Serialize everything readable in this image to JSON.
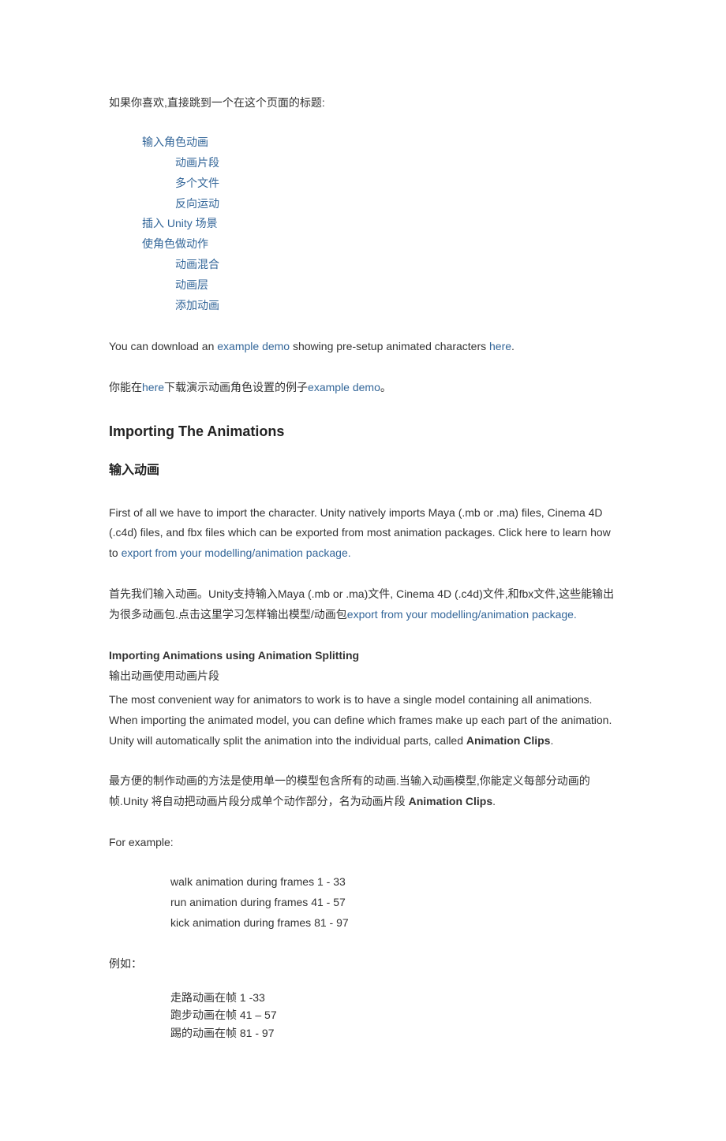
{
  "intro_zh": "如果你喜欢,直接跳到一个在这个页面的标题:",
  "toc": {
    "a": "输入角色动画",
    "a1": "动画片段",
    "a2": "多个文件",
    "a3": "反向运动",
    "b": "插入 Unity 场景",
    "c": "使角色做动作",
    "c1": "动画混合",
    "c2": "动画层",
    "c3": "添加动画"
  },
  "dl_en_1": "You can download an ",
  "dl_en_link1": "example demo",
  "dl_en_2": " showing pre-setup animated characters ",
  "dl_en_link2": "here",
  "dl_en_3": ".",
  "dl_zh_1": "你能在",
  "dl_zh_link1": "here",
  "dl_zh_2": "下载演示动画角色设置的例子",
  "dl_zh_link2": "example demo",
  "dl_zh_3": "。",
  "h2_en": "Importing The Animations",
  "h3_zh": "输入动画",
  "import_en_1": "First of all we have to import the character. Unity natively imports Maya (.mb or .ma) files, Cinema 4D (.c4d) files, and fbx files which can be exported from most animation packages. Click here to learn how to ",
  "import_en_link": "export from your modelling/animation package.",
  "import_zh_1": "首先我们输入动画。Unity支持输入Maya (.mb or .ma)文件, Cinema 4D (.c4d)文件,和fbx文件,这些能输出为很多动画包.点击这里学习怎样输出模型/动画包",
  "import_zh_link": "export from your modelling/animation package.",
  "split_h_en": "Importing Animations using Animation Splitting",
  "split_h_zh": "输出动画使用动画片段",
  "split_body_en_1": "The most convenient way for animators to work is to have a single model containing all animations. When importing the animated model, you can define which frames make up each part of the animation. Unity will automatically split the animation into the individual parts, called ",
  "split_body_en_bold": "Animation Clips",
  "split_body_en_2": ".",
  "split_body_zh_1": "最方便的制作动画的方法是使用单一的模型包含所有的动画.当输入动画模型,你能定义每部分动画的帧.Unity 将自动把动画片段分成单个动作部分，名为动画片段 ",
  "split_body_zh_bold": "Animation Clips",
  "split_body_zh_2": ".",
  "for_example": "For example:",
  "ex_en_1": "walk animation during frames 1 - 33",
  "ex_en_2": "run animation during frames 41 - 57",
  "ex_en_3": "kick animation during frames 81 - 97",
  "for_example_zh": "例如：",
  "ex_zh_1": "走路动画在帧 1 -33",
  "ex_zh_2": "跑步动画在帧 41 – 57",
  "ex_zh_3": "踢的动画在帧 81 - 97"
}
